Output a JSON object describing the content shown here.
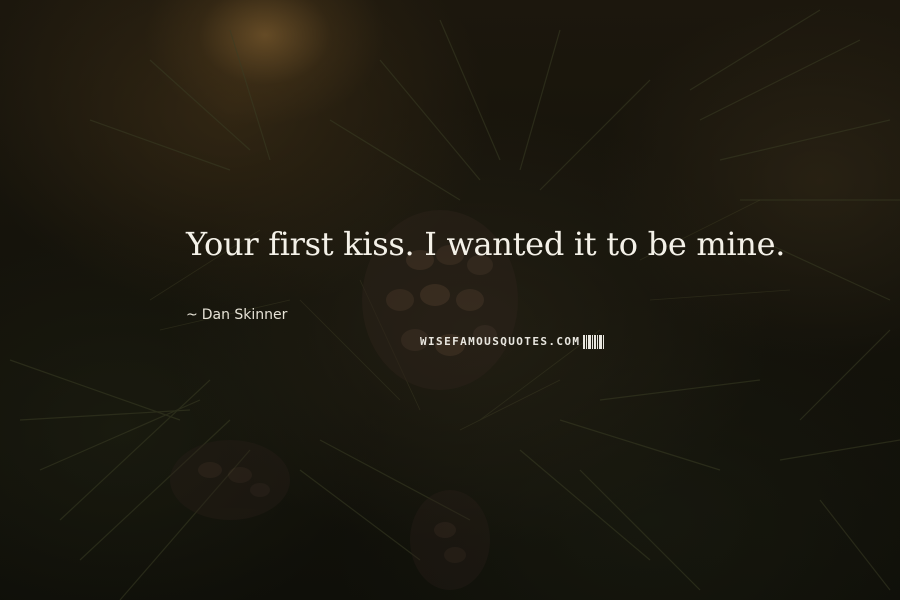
{
  "quote": {
    "text": "Your first kiss. I wanted it to be mine.",
    "author": "Dan Skinner",
    "author_prefix": "~"
  },
  "watermark": {
    "text": "WISEFAMOUSQUOTES.COM"
  },
  "colors": {
    "text": "#f4f1e8",
    "background": "#15130b",
    "pinecone": "#5a4030",
    "needles": "#2f3420"
  }
}
